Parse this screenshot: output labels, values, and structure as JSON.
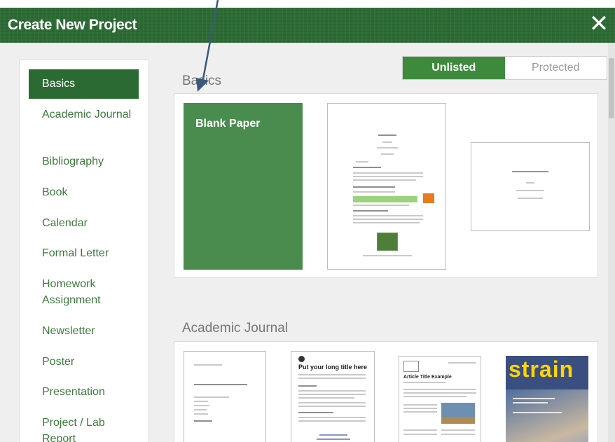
{
  "dialog": {
    "title": "Create New Project",
    "close_glyph": "✕"
  },
  "sidebar": {
    "items": [
      {
        "label": "Basics",
        "active": true
      },
      {
        "label": "Academic Journal"
      },
      {
        "label": "Bibliography"
      },
      {
        "label": "Book"
      },
      {
        "label": "Calendar"
      },
      {
        "label": "Formal Letter"
      },
      {
        "label": "Homework Assignment"
      },
      {
        "label": "Newsletter"
      },
      {
        "label": "Poster"
      },
      {
        "label": "Presentation"
      },
      {
        "label": "Project / Lab Report"
      }
    ]
  },
  "visibility_toggle": {
    "options": [
      {
        "label": "Unlisted",
        "selected": true
      },
      {
        "label": "Protected",
        "selected": false
      }
    ]
  },
  "sections": [
    {
      "title": "Basics",
      "templates": [
        {
          "label": "Blank Paper"
        },
        {
          "icon": "paper-template-thumbnail"
        },
        {
          "icon": "presentation-template-thumbnail"
        }
      ]
    },
    {
      "title": "Academic Journal",
      "templates": [
        {
          "icon": "journal-template-thumbnail"
        },
        {
          "label": "Put your long title here"
        },
        {
          "label": "Article Title Example"
        },
        {
          "label": "strain"
        }
      ]
    }
  ],
  "colors": {
    "header_green": "#2c6b34",
    "active_green": "#2b6b33",
    "link_green": "#3d7a3d",
    "toggle_green": "#3d8a3d",
    "blank_tile_green": "#4a8c4e",
    "annotation_arrow": "#3a5a7a"
  }
}
